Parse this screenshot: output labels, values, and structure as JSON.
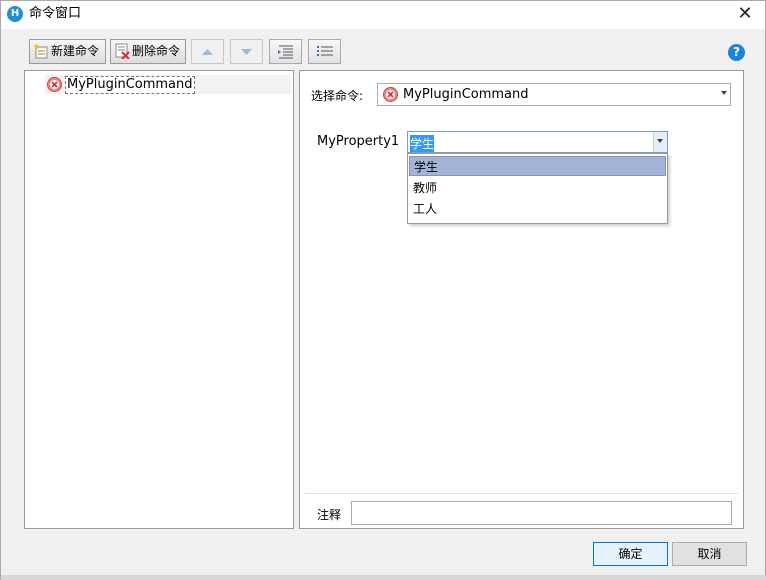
{
  "window": {
    "title": "命令窗口",
    "app_icon_letter": "H",
    "close_glyph": "✕"
  },
  "toolbar": {
    "new_label": "新建命令",
    "delete_label": "删除命令",
    "help_glyph": "?"
  },
  "tree": {
    "items": [
      {
        "label": "MyPluginCommand",
        "icon": "error-circle-icon"
      }
    ]
  },
  "editor": {
    "select_command_label": "选择命令:",
    "selected_command": "MyPluginCommand",
    "property_name": "MyProperty1",
    "property_value": "学生",
    "dropdown_options": [
      "学生",
      "教师",
      "工人"
    ],
    "dropdown_selected_index": 0,
    "note_label": "注释",
    "note_value": ""
  },
  "buttons": {
    "ok_label": "确定",
    "cancel_label": "取消"
  },
  "colors": {
    "accent": "#1e90d6",
    "error_red": "#e05555",
    "selection": "#a3b4d7"
  }
}
